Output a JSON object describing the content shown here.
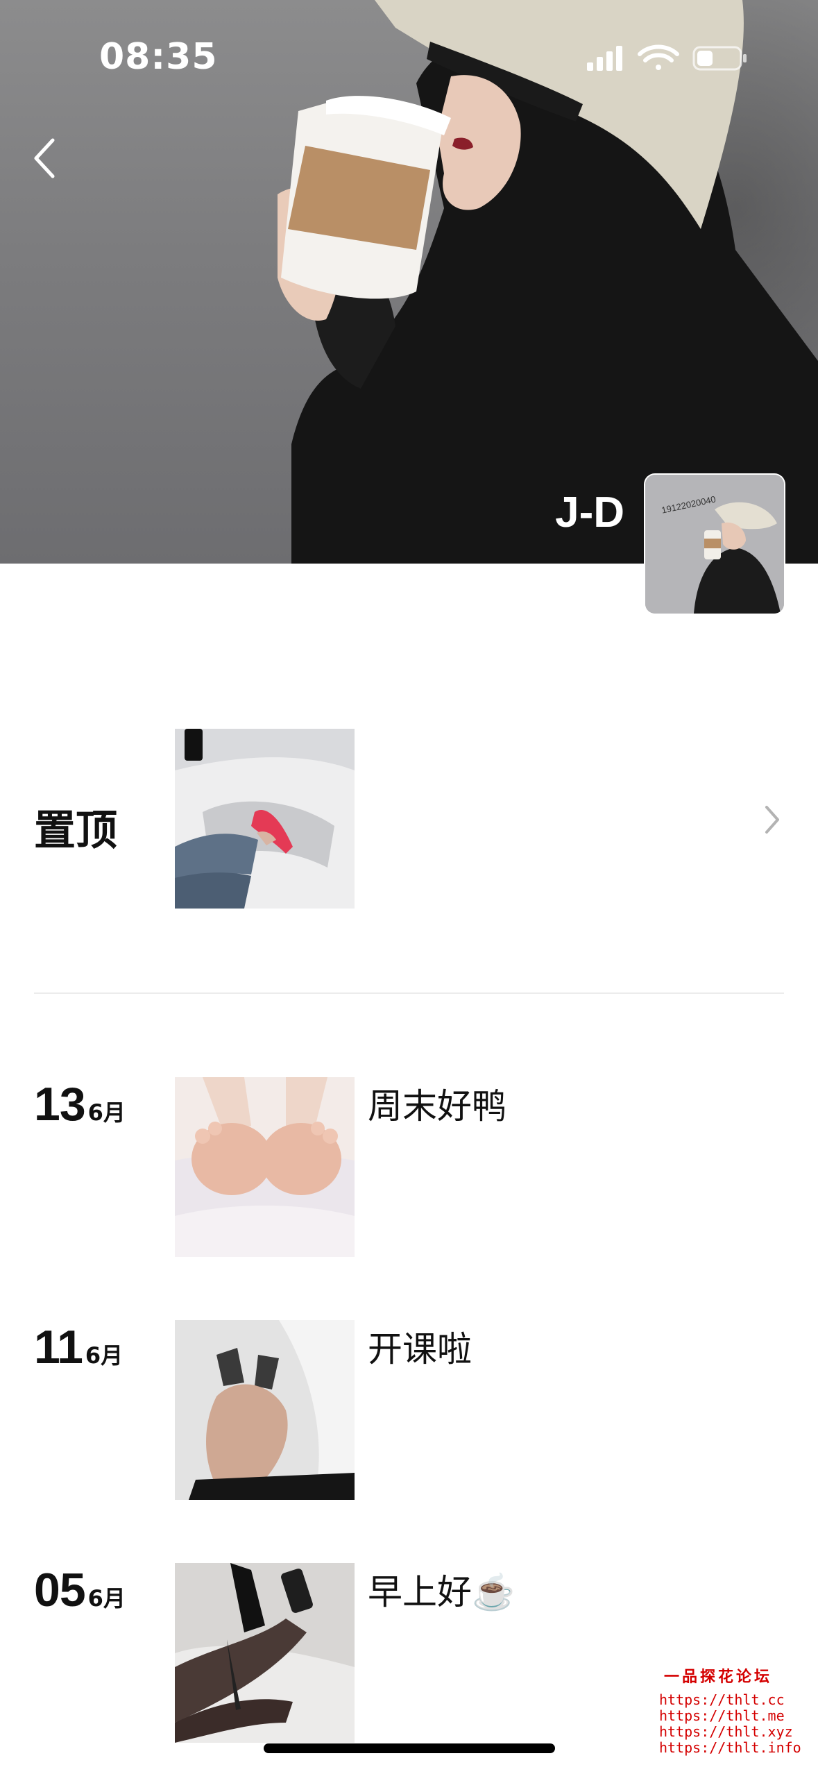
{
  "status_bar": {
    "time": "08:35"
  },
  "profile": {
    "name": "J-D",
    "avatar_caption": "19122020040"
  },
  "pinned": {
    "label": "置顶"
  },
  "posts": [
    {
      "day": "13",
      "month": "6月",
      "text": "周末好鸭"
    },
    {
      "day": "11",
      "month": "6月",
      "text": "开课啦"
    },
    {
      "day": "05",
      "month": "6月",
      "text": "早上好☕️"
    }
  ],
  "watermark": {
    "title": "一品探花论坛",
    "urls": [
      "https://thlt.cc",
      "https://thlt.me",
      "https://thlt.xyz",
      "https://thlt.info"
    ]
  }
}
